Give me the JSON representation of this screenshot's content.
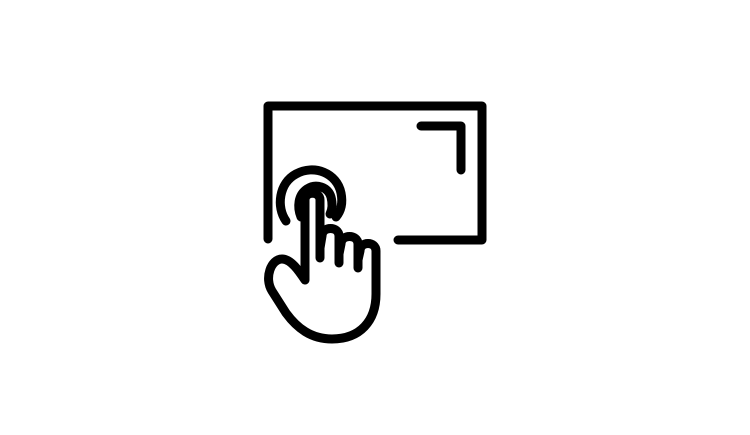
{
  "icon": {
    "name": "touch-screen-tap-icon",
    "stroke_color": "#000000",
    "background_color": "#ffffff"
  }
}
